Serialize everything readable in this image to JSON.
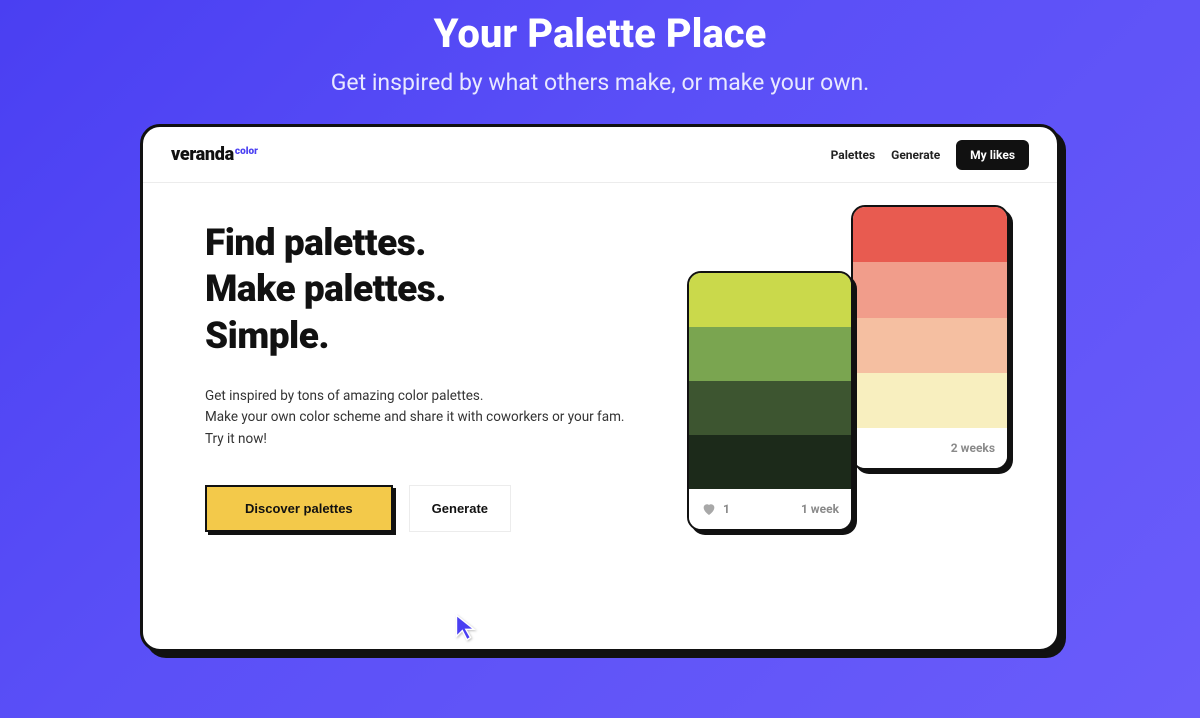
{
  "outer": {
    "title": "Your Palette Place",
    "subtitle": "Get inspired by what others make, or make your own."
  },
  "brand": {
    "main": "veranda",
    "sup": "color"
  },
  "nav": {
    "palettes": "Palettes",
    "generate": "Generate",
    "mylikes": "My likes"
  },
  "hero": {
    "l1": "Find palettes.",
    "l2": "Make palettes.",
    "l3": "Simple."
  },
  "desc": {
    "l1": "Get inspired by tons of amazing color palettes.",
    "l2": "Make your own color scheme and share it with coworkers or your fam.",
    "l3": "Try it now!"
  },
  "cta": {
    "primary": "Discover palettes",
    "secondary": "Generate"
  },
  "cards": {
    "back": {
      "colors": [
        "#e85b50",
        "#f19d8b",
        "#f5bfa1",
        "#f8efbf"
      ],
      "time": "2 weeks"
    },
    "front": {
      "colors": [
        "#cad94b",
        "#7aa550",
        "#3d5530",
        "#1c2a1a"
      ],
      "likes": "1",
      "time": "1 week"
    }
  }
}
